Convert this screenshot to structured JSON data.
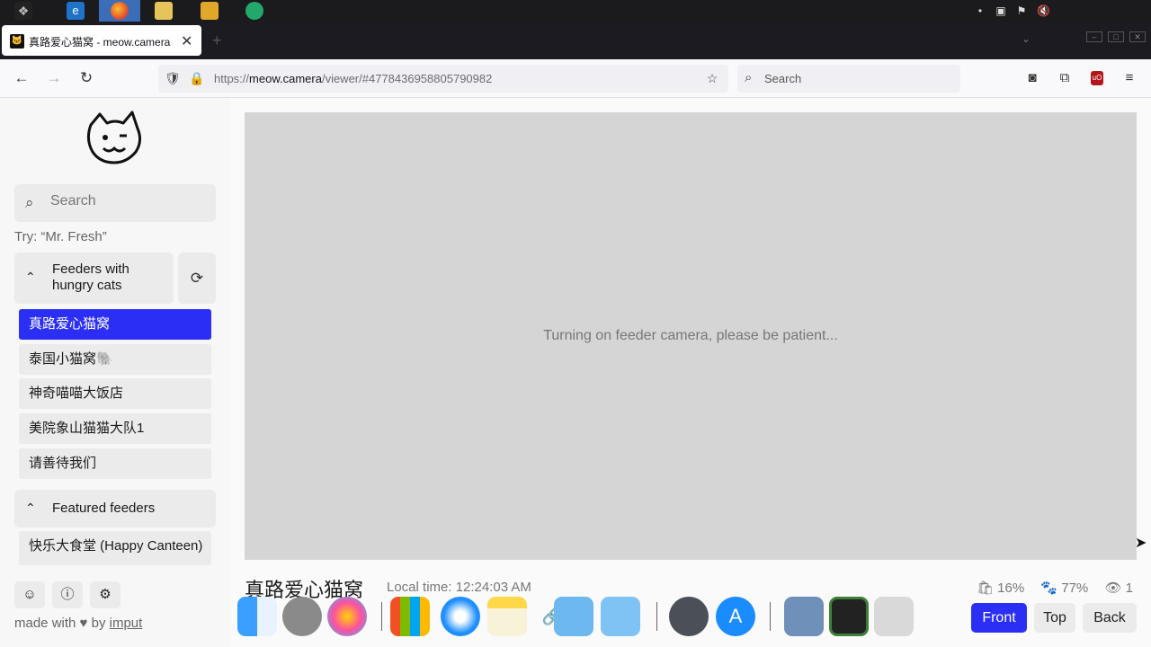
{
  "browser": {
    "tab_title": "真路爱心猫窝 - meow.camera",
    "tab_favicon": "🐱",
    "new_tab_label": "+",
    "url_prefix": "https://",
    "url_host": "meow.camera",
    "url_path": "/viewer/#4778436958805790982",
    "search_placeholder": "Search"
  },
  "sidebar": {
    "search_placeholder": "Search",
    "try_hint": "Try: “Mr. Fresh”",
    "groups": [
      {
        "label": "Feeders with hungry cats",
        "expanded": true
      },
      {
        "label": "Featured feeders",
        "expanded": true
      }
    ],
    "hungry_feeders": [
      {
        "label": "真路爱心猫窝",
        "active": true
      },
      {
        "label": "泰国小猫窝🐘",
        "active": false
      },
      {
        "label": "神奇喵喵大饭店",
        "active": false
      },
      {
        "label": "美院象山猫猫大队1",
        "active": false
      },
      {
        "label": "请善待我们",
        "active": false
      }
    ],
    "featured_feeders": [
      {
        "label": "快乐大食堂 (Happy Canteen)"
      }
    ],
    "footer": {
      "made_with": "made with",
      "heart": "♥",
      "by": "by",
      "author": "imput"
    }
  },
  "viewer": {
    "status_message": "Turning on feeder camera, please be patient...",
    "feeder_name": "真路爱心猫窝",
    "local_time": "Local time: 12:24:03 AM",
    "stats": {
      "food_level": "16%",
      "activity": "77%",
      "viewers": "1"
    },
    "camera_buttons": [
      {
        "label": "Front",
        "active": true
      },
      {
        "label": "Top",
        "active": false
      },
      {
        "label": "Back",
        "active": false
      }
    ]
  },
  "colors": {
    "accent": "#2b2ff5",
    "browser_dark": "#1c1b22",
    "video_placeholder": "#d5d5d5"
  }
}
